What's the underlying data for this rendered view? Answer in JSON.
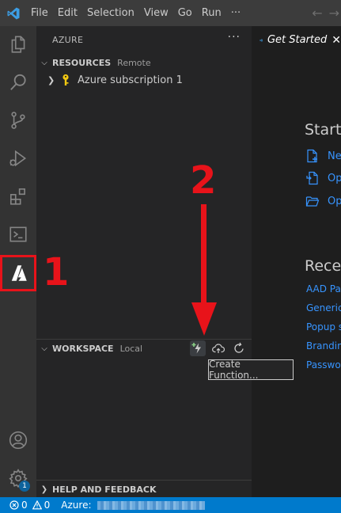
{
  "titlebar": {
    "menu": [
      "File",
      "Edit",
      "Selection",
      "View",
      "Go",
      "Run"
    ],
    "more": "···"
  },
  "activity": {
    "icons": [
      "explorer-icon",
      "search-icon",
      "source-control-icon",
      "run-debug-icon",
      "extensions-icon",
      "terminal-icon",
      "azure-icon",
      "account-icon",
      "settings-icon"
    ],
    "settings_badge": "1"
  },
  "sidebar": {
    "title": "AZURE",
    "more": "···",
    "resources": {
      "label": "RESOURCES",
      "sub": "Remote"
    },
    "subscription": "Azure subscription 1",
    "workspace": {
      "label": "WORKSPACE",
      "sub": "Local"
    },
    "help": {
      "label": "HELP AND FEEDBACK"
    }
  },
  "tooltip": "Create Function...",
  "editor": {
    "tab_label": "Get Started",
    "start_heading": "Start",
    "start_links": [
      "Ne",
      "Op",
      "Op"
    ],
    "recent_heading": "Recen",
    "recent_links": [
      "AAD Pa",
      "Generic",
      "Popup s",
      "Brandin",
      "Passwor"
    ]
  },
  "statusbar": {
    "errors": "0",
    "warnings": "0",
    "azure_label": "Azure:"
  },
  "annotations": {
    "one": "1",
    "two": "2"
  },
  "colors": {
    "accent": "#007acc",
    "annotation": "#e8131a",
    "link": "#3794ff"
  }
}
